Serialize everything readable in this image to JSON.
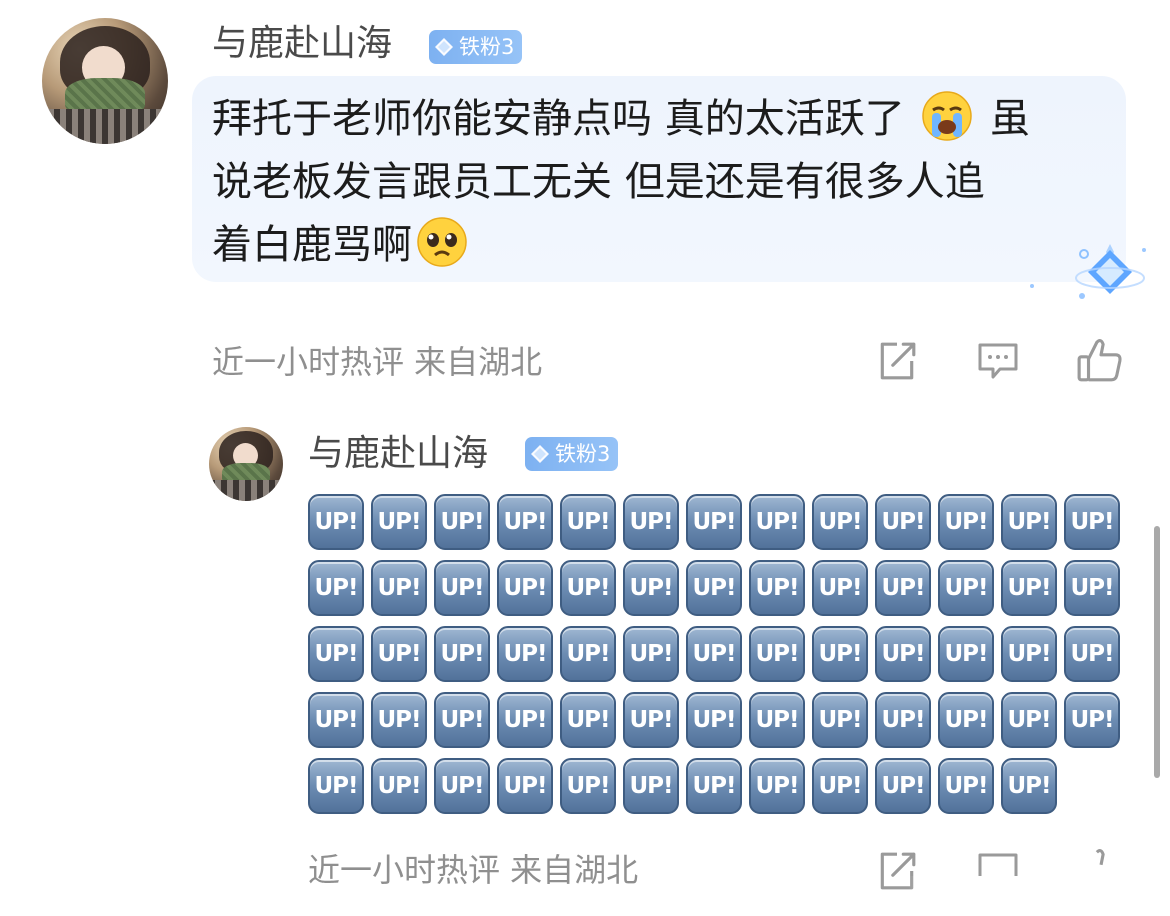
{
  "comments": [
    {
      "username": "与鹿赴山海",
      "badge": "铁粉3",
      "text_line1_a": "拜托于老师你能安静点吗 真的太活跃了",
      "text_line1_b": "虽",
      "text_line2": "说老板发言跟员工无关 但是还是有很多人追",
      "text_line3": "着白鹿骂啊",
      "emoji1": "loudly-crying-face",
      "emoji2": "pleading-face",
      "meta": "近一小时热评  来自湖北",
      "actions": [
        "share-icon",
        "comment-icon",
        "like-icon"
      ]
    },
    {
      "username": "与鹿赴山海",
      "badge": "铁粉3",
      "up_emoji_label": "UP!",
      "up_emoji_count": 64,
      "meta": "近一小时热评  来自湖北",
      "actions": [
        "share-icon",
        "comment-icon",
        "like-icon"
      ]
    }
  ],
  "colors": {
    "badge": "#7db1f1",
    "bubble": "#eef4fd",
    "meta_text": "#8f8f8f",
    "up_emoji": "#6d8db3"
  }
}
